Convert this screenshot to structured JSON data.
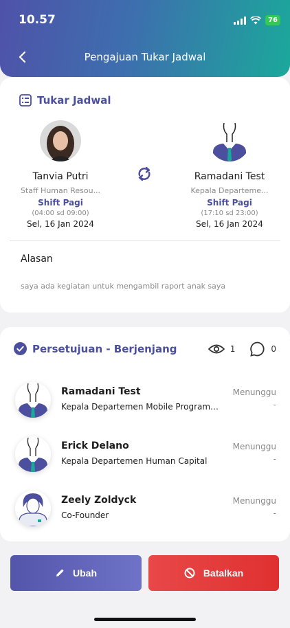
{
  "status_bar": {
    "time": "10.57",
    "battery": "76"
  },
  "header": {
    "title": "Pengajuan Tukar Jadwal"
  },
  "swap_section": {
    "title": "Tukar Jadwal",
    "requester": {
      "name": "Tanvia Putri",
      "role": "Staff Human Resou...",
      "shift": "Shift Pagi",
      "time": "(04:00 sd 09:00)",
      "date": "Sel, 16 Jan 2024"
    },
    "target": {
      "name": "Ramadani Test",
      "role": "Kepala Departeme...",
      "shift": "Shift Pagi",
      "time": "(17:10 sd 23:00)",
      "date": "Sel, 16 Jan 2024"
    },
    "reason_label": "Alasan",
    "reason_text": "saya ada kegiatan untuk mengambil raport anak saya"
  },
  "approval_section": {
    "title": "Persetujuan - Berjenjang",
    "views_count": "1",
    "comments_count": "0",
    "approvers": [
      {
        "name": "Ramadani Test",
        "role": "Kepala Departemen Mobile Programming",
        "status": "Menunggu",
        "date": "-"
      },
      {
        "name": "Erick Delano",
        "role": "Kepala Departemen Human Capital",
        "status": "Menunggu",
        "date": "-"
      },
      {
        "name": "Zeely Zoldyck",
        "role": "Co-Founder",
        "status": "Menunggu",
        "date": "-"
      }
    ]
  },
  "actions": {
    "edit_label": "Ubah",
    "cancel_label": "Batalkan"
  },
  "colors": {
    "accent": "#4b4f9e",
    "danger": "#e84848",
    "header_start": "#4f52a9",
    "header_end": "#1ba89b"
  }
}
